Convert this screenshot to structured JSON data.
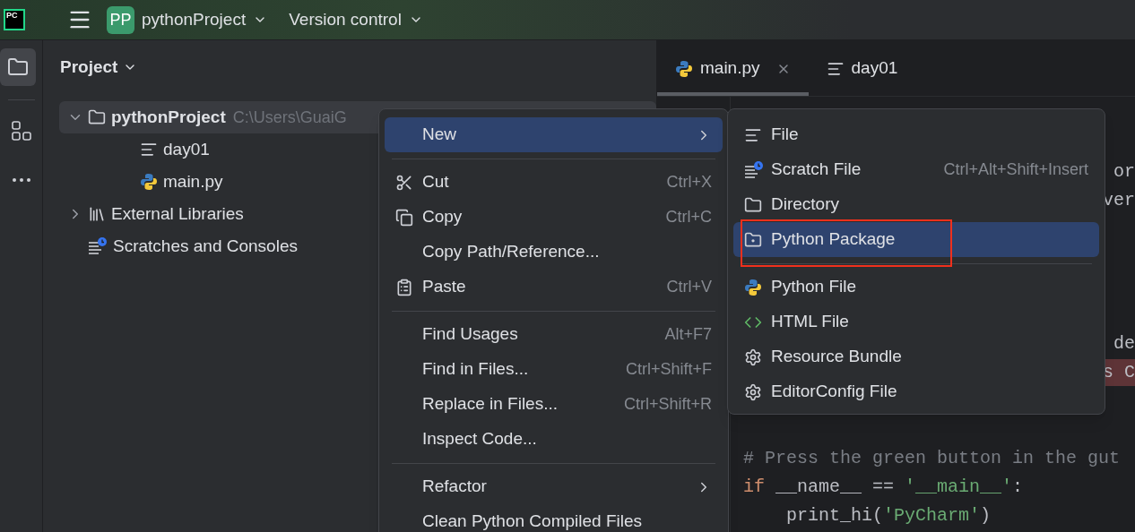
{
  "topbar": {
    "logo": "PC",
    "project_badge": "PP",
    "project": "pythonProject",
    "vcs": "Version control"
  },
  "tool_strip": [
    {
      "kind": "folder",
      "selected": true
    },
    {
      "kind": "structure",
      "selected": false
    },
    {
      "kind": "more",
      "selected": false
    }
  ],
  "project_panel": {
    "title": "Project",
    "tree": [
      {
        "label": "pythonProject",
        "path": "C:\\Users\\GuaiG",
        "kind": "folder",
        "expanded": true,
        "selected": true,
        "children": [
          {
            "label": "day01",
            "kind": "text",
            "selected": false
          },
          {
            "label": "main.py",
            "kind": "python",
            "selected": false
          }
        ]
      },
      {
        "label": "External Libraries",
        "kind": "library",
        "expanded": false,
        "selected": false
      },
      {
        "label": "Scratches and Consoles",
        "kind": "scratch",
        "selected": false
      }
    ]
  },
  "editor": {
    "tabs": [
      {
        "label": "main.py",
        "kind": "python",
        "selected": true,
        "closable": true
      },
      {
        "label": "day01",
        "kind": "text",
        "selected": false,
        "closable": false
      }
    ],
    "lines": [
      {
        "kind": "covered"
      },
      {
        "kind": "covered"
      },
      {
        "kind": "fragment",
        "error": false,
        "segments": [
          {
            "text": "or",
            "kind": "plain"
          }
        ]
      },
      {
        "kind": "fragment",
        "error": false,
        "segments": [
          {
            "text": "ver",
            "kind": "plain"
          }
        ]
      },
      {
        "kind": "covered"
      },
      {
        "kind": "covered"
      },
      {
        "kind": "covered"
      },
      {
        "kind": "covered"
      },
      {
        "kind": "fragment",
        "error": false,
        "segments": [
          {
            "text": "de",
            "kind": "plain"
          }
        ]
      },
      {
        "kind": "fragment",
        "error": true,
        "segments": [
          {
            "text": "s C",
            "kind": "plain"
          }
        ]
      },
      {
        "kind": "covered"
      },
      {
        "kind": "covered"
      },
      {
        "kind": "code",
        "error": false,
        "segments": [
          {
            "text": "# Press the green button in the gut",
            "kind": "comment"
          }
        ]
      },
      {
        "kind": "code",
        "error": false,
        "segments": [
          {
            "text": "if",
            "kind": "keyword"
          },
          {
            "text": " __name__ == ",
            "kind": "plain"
          },
          {
            "text": "'__main__'",
            "kind": "string"
          },
          {
            "text": ":",
            "kind": "plain"
          }
        ]
      },
      {
        "kind": "code",
        "error": false,
        "segments": [
          {
            "text": "    print_hi(",
            "kind": "plain"
          },
          {
            "text": "'PyCharm'",
            "kind": "string"
          },
          {
            "text": ")",
            "kind": "plain"
          }
        ]
      }
    ]
  },
  "context_menu": {
    "items": [
      {
        "kind": "plain",
        "label": "New",
        "submenu": true,
        "selected": true
      },
      {
        "kind": "separator"
      },
      {
        "kind": "scissors",
        "label": "Cut",
        "shortcut": "Ctrl+X",
        "submenu": false,
        "selected": false
      },
      {
        "kind": "copy",
        "label": "Copy",
        "shortcut": "Ctrl+C",
        "submenu": false,
        "selected": false
      },
      {
        "kind": "plain",
        "label": "Copy Path/Reference...",
        "submenu": false,
        "selected": false
      },
      {
        "kind": "paste",
        "label": "Paste",
        "shortcut": "Ctrl+V",
        "submenu": false,
        "selected": false
      },
      {
        "kind": "separator"
      },
      {
        "kind": "plain",
        "label": "Find Usages",
        "shortcut": "Alt+F7",
        "submenu": false,
        "selected": false
      },
      {
        "kind": "plain",
        "label": "Find in Files...",
        "shortcut": "Ctrl+Shift+F",
        "submenu": false,
        "selected": false
      },
      {
        "kind": "plain",
        "label": "Replace in Files...",
        "shortcut": "Ctrl+Shift+R",
        "submenu": false,
        "selected": false
      },
      {
        "kind": "plain",
        "label": "Inspect Code...",
        "submenu": false,
        "selected": false
      },
      {
        "kind": "separator"
      },
      {
        "kind": "plain",
        "label": "Refactor",
        "submenu": true,
        "selected": false
      },
      {
        "kind": "plain",
        "label": "Clean Python Compiled Files",
        "submenu": false,
        "selected": false
      }
    ]
  },
  "new_submenu": {
    "items": [
      {
        "kind": "text",
        "label": "File",
        "selected": false,
        "highlighted": false
      },
      {
        "kind": "scratch",
        "label": "Scratch File",
        "shortcut": "Ctrl+Alt+Shift+Insert",
        "selected": false,
        "highlighted": false
      },
      {
        "kind": "folder",
        "label": "Directory",
        "selected": false,
        "highlighted": false
      },
      {
        "kind": "package",
        "label": "Python Package",
        "selected": true,
        "highlighted": true
      },
      {
        "kind": "separator"
      },
      {
        "kind": "python",
        "label": "Python File",
        "selected": false,
        "highlighted": false
      },
      {
        "kind": "html",
        "label": "HTML File",
        "selected": false,
        "highlighted": false
      },
      {
        "kind": "gear",
        "label": "Resource Bundle",
        "selected": false,
        "highlighted": false
      },
      {
        "kind": "gear",
        "label": "EditorConfig File",
        "selected": false,
        "highlighted": false
      }
    ]
  }
}
